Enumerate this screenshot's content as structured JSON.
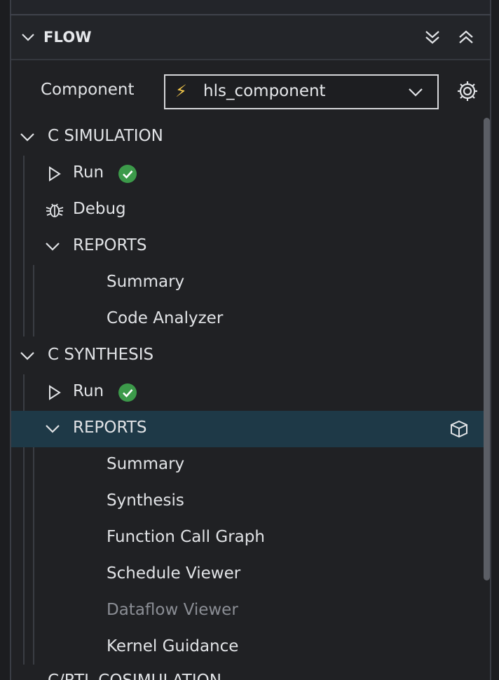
{
  "panel": {
    "title": "FLOW",
    "component_label": "Component",
    "component_value": "hls_component"
  },
  "groups": [
    {
      "title": "C SIMULATION",
      "run_label": "Run",
      "debug_label": "Debug",
      "reports_label": "REPORTS",
      "reports": [
        "Summary",
        "Code Analyzer"
      ]
    },
    {
      "title": "C SYNTHESIS",
      "run_label": "Run",
      "reports_label": "REPORTS",
      "reports": [
        "Summary",
        "Synthesis",
        "Function Call Graph",
        "Schedule Viewer",
        "Dataflow Viewer",
        "Kernel Guidance"
      ]
    },
    {
      "title": "C/RTL COSIMULATION"
    }
  ],
  "colors": {
    "accent_bolt": "#f3c74a",
    "status_success": "#3c9a4a",
    "selected_row": "#1e3947"
  }
}
